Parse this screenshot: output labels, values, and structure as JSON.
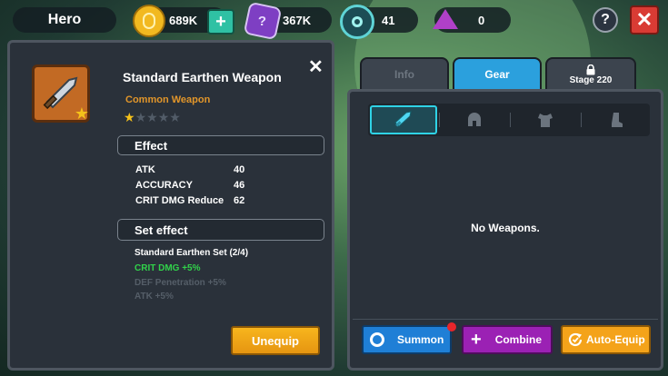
{
  "header": {
    "title": "Hero",
    "gold": "689K",
    "gems": "367K",
    "tokens": "41",
    "crystals": "0",
    "help_label": "?",
    "close_label": "✕"
  },
  "item": {
    "name": "Standard Earthen Weapon",
    "rarity": "Common Weapon",
    "stars_filled": 1,
    "stars_total": 5,
    "close_label": "✕",
    "effect_title": "Effect",
    "stats": [
      {
        "label": "ATK",
        "value": "40"
      },
      {
        "label": "ACCURACY",
        "value": "46"
      },
      {
        "label": "CRIT DMG Reduce",
        "value": "62"
      }
    ],
    "set_title": "Set effect",
    "set_name": "Standard Earthen Set (2/4)",
    "set_bonuses": [
      {
        "text": "CRIT DMG +5%",
        "active": true
      },
      {
        "text": "DEF Penetration +5%",
        "active": false
      },
      {
        "text": "ATK +5%",
        "active": false
      }
    ],
    "unequip_label": "Unequip"
  },
  "tabs": [
    {
      "label": "Info",
      "active": false,
      "locked": false
    },
    {
      "label": "Gear",
      "active": true,
      "locked": false
    },
    {
      "label": "Stage 220",
      "active": false,
      "locked": true
    }
  ],
  "gear": {
    "categories": [
      {
        "name": "weapon",
        "icon": "sword-icon",
        "active": true
      },
      {
        "name": "helmet",
        "icon": "helmet-icon",
        "active": false
      },
      {
        "name": "armor",
        "icon": "armor-icon",
        "active": false
      },
      {
        "name": "boots",
        "icon": "boot-icon",
        "active": false
      }
    ],
    "empty_text": "No Weapons.",
    "summon_label": "Summon",
    "combine_label": "Combine",
    "auto_equip_label": "Auto-Equip"
  },
  "colors": {
    "gold_button": "#f7b51d",
    "gear_tab": "#2ba0dd",
    "summon": "#1f7fd6",
    "combine": "#9b21b4",
    "auto_equip": "#f4a31a",
    "rarity_orange": "#e2962a",
    "active_bonus_green": "#31d24a"
  }
}
